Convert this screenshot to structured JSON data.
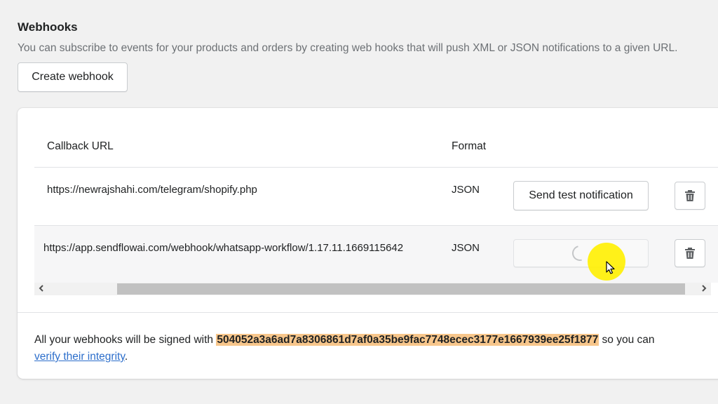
{
  "section": {
    "title": "Webhooks",
    "description": "You can subscribe to events for your products and orders by creating web hooks that will push XML or JSON notifications to a given URL.",
    "create_button": "Create webhook"
  },
  "table": {
    "headers": {
      "callback_url": "Callback URL",
      "format": "Format"
    },
    "rows": [
      {
        "url": "https://newrajshahi.com/telegram/shopify.php",
        "format": "JSON",
        "action_label": "Send test notification",
        "action_state": "idle"
      },
      {
        "url": "https://app.sendflowai.com/webhook/whatsapp-workflow/1.17.11.1669115642",
        "format": "JSON",
        "action_label": "",
        "action_state": "loading"
      }
    ]
  },
  "footer": {
    "prefix": "All your webhooks will be signed with",
    "signature": "504052a3a6ad7a8306861d7af0a35be9fac7748ecec3177e1667939ee25f1877",
    "suffix": "so you can",
    "link_text": "verify their integrity",
    "end": "."
  },
  "colors": {
    "hash_highlight": "#f7c68b",
    "link": "#2c6ecb",
    "cursor_halo": "#fff000"
  },
  "icons": [
    "trash-icon",
    "spinner-icon",
    "chevron-left-icon",
    "chevron-right-icon",
    "mouse-cursor-icon"
  ]
}
